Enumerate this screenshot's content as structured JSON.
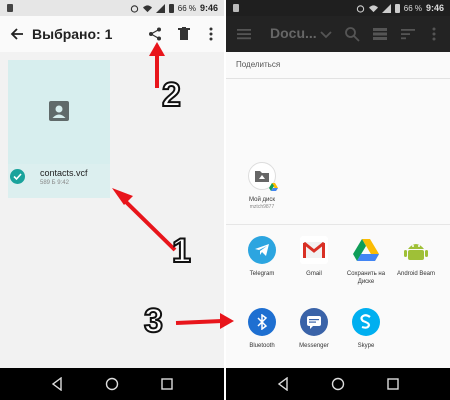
{
  "left_screen": {
    "status": {
      "battery": "66 %",
      "time": "9:46"
    },
    "toolbar": {
      "title": "Выбрано: 1"
    },
    "file": {
      "name": "contacts.vcf",
      "meta": "589 Б  9:42"
    }
  },
  "right_screen": {
    "status": {
      "battery": "66 %",
      "time": "9:46"
    },
    "toolbar": {
      "title": "Docu..."
    },
    "share_sheet": {
      "label": "Поделиться",
      "drive_target": {
        "label": "Мой диск",
        "account": "mztch9877"
      },
      "apps": [
        {
          "label": "Telegram"
        },
        {
          "label": "Gmail"
        },
        {
          "label": "Сохранить на Диске"
        },
        {
          "label": "Android Beam"
        },
        {
          "label": "Bluetooth"
        },
        {
          "label": "Messenger"
        },
        {
          "label": "Skype"
        }
      ]
    }
  },
  "annotations": {
    "step1": "1",
    "step2": "2",
    "step3": "3"
  },
  "colors": {
    "arrow": "#e8151b",
    "teal": "#1aa39c",
    "card": "#d7eeee"
  }
}
